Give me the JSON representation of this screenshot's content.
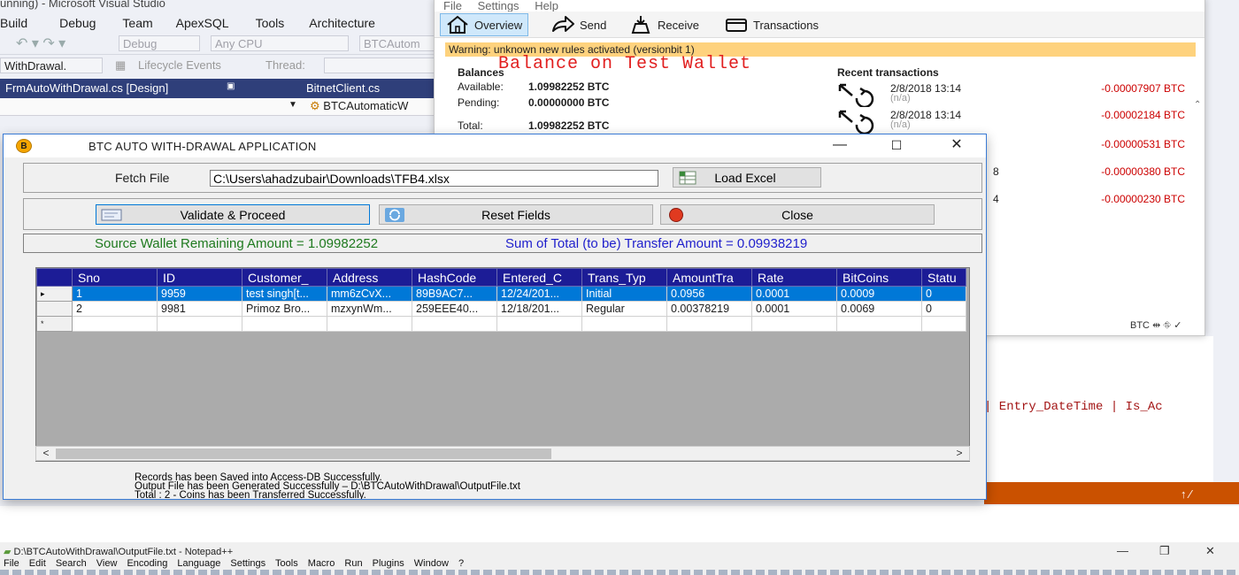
{
  "vs": {
    "title": "unning) - Microsoft Visual Studio",
    "menu": [
      "Build",
      "Debug",
      "Team",
      "ApexSQL",
      "Tools",
      "Architecture"
    ],
    "config_combo": "Debug",
    "platform_combo": "Any CPU",
    "project_combo": "BTCAutom",
    "event_combo": "WithDrawal.",
    "lifecycle_label": "Lifecycle Events",
    "thread_label": "Thread:",
    "tabs": [
      "FrmAutoWithDrawal.cs [Design]",
      "BitnetClient.cs"
    ],
    "nav_combo": "BTCAutomaticW",
    "sql_line": "| Entry_DateTime | Is_Ac"
  },
  "wallet": {
    "menu": [
      "File",
      "Settings",
      "Help"
    ],
    "tabs": [
      {
        "label": "Overview",
        "icon": "home-icon"
      },
      {
        "label": "Send",
        "icon": "send-arrow-icon"
      },
      {
        "label": "Receive",
        "icon": "receive-icon"
      },
      {
        "label": "Transactions",
        "icon": "transactions-icon"
      }
    ],
    "warning": "Warning: unknown new rules activated (versionbit 1)",
    "overlay_title": "Balance on Test Wallet",
    "balances_heading": "Balances",
    "available_label": "Available:",
    "available_value": "1.09982252 BTC",
    "pending_label": "Pending:",
    "pending_value": "0.00000000 BTC",
    "total_label": "Total:",
    "total_value": "1.09982252 BTC",
    "recent_heading": "Recent transactions",
    "transactions": [
      {
        "date": "2/8/2018 13:14",
        "note": "(n/a)",
        "amount": "-0.00007907 BTC"
      },
      {
        "date": "2/8/2018 13:14",
        "note": "(n/a)",
        "amount": "-0.00002184 BTC"
      },
      {
        "date": "",
        "note": "",
        "amount": "-0.00000531 BTC"
      },
      {
        "date": "8",
        "note": "",
        "amount": "-0.00000380 BTC"
      },
      {
        "date": "4",
        "note": "",
        "amount": "-0.00000230 BTC"
      }
    ],
    "footer": "BTC"
  },
  "app": {
    "title": "BTC AUTO WITH-DRAWAL APPLICATION",
    "logo": "B",
    "fetch_label": "Fetch File",
    "fetch_path": "C:\\Users\\ahadzubair\\Downloads\\TFB4.xlsx",
    "load_excel": "Load Excel",
    "validate": "Validate & Proceed",
    "reset": "Reset Fields",
    "close": "Close",
    "remaining": "Source Wallet Remaining Amount = 1.09982252",
    "sum_total": "Sum of Total (to be) Transfer Amount = 0.09938219",
    "columns": [
      "Sno",
      "ID",
      "Customer_",
      "Address",
      "HashCode",
      "Entered_C",
      "Trans_Typ",
      "AmountTra",
      "Rate",
      "BitCoins",
      "Statu"
    ],
    "rows": [
      {
        "marker": "▸",
        "cells": [
          "1",
          "9959",
          "test singh[t...",
          "mm6zCvX...",
          "89B9AC7...",
          "12/24/201...",
          "Initial",
          "0.0956",
          "0.0001",
          "0.0009",
          "0"
        ]
      },
      {
        "marker": "",
        "cells": [
          "2",
          "9981",
          "Primoz Bro...",
          "mzxynWm...",
          "259EEE40...",
          "12/18/201...",
          "Regular",
          "0.00378219",
          "0.0001",
          "0.0069",
          "0"
        ]
      },
      {
        "marker": "*",
        "cells": [
          "",
          "",
          "",
          "",
          "",
          "",
          "",
          "",
          "",
          "",
          ""
        ]
      }
    ],
    "messages": [
      "Records has been Saved into Access-DB Successfully.",
      " Output File has been Generated Successfully – D:\\BTCAutoWithDrawal\\OutputFile.txt",
      " Total : 2 - Coins has been Transferred Successfully."
    ]
  },
  "npp": {
    "title": "D:\\BTCAutoWithDrawal\\OutputFile.txt - Notepad++",
    "menu": [
      "File",
      "Edit",
      "Search",
      "View",
      "Encoding",
      "Language",
      "Settings",
      "Tools",
      "Macro",
      "Run",
      "Plugins",
      "Window",
      "?"
    ]
  }
}
